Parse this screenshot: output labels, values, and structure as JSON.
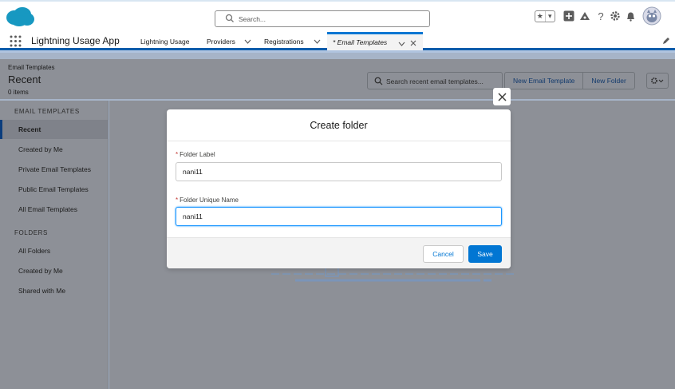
{
  "global_header": {
    "search_placeholder": "Search...",
    "icons": [
      "favorites-star-icon",
      "favorites-dropdown-icon",
      "add-icon",
      "trailhead-icon",
      "help-icon",
      "setup-gear-icon",
      "notifications-bell-icon",
      "user-avatar"
    ]
  },
  "nav": {
    "app_name": "Lightning Usage App",
    "items": [
      {
        "label": "Lightning Usage"
      },
      {
        "label": "Providers"
      },
      {
        "label": "Registrations"
      }
    ],
    "active_tab": {
      "label": "* Email Templates"
    }
  },
  "page_header": {
    "object_label": "Email Templates",
    "title": "Recent",
    "count": "0 items",
    "search_placeholder": "Search recent email templates...",
    "buttons": {
      "new_template": "New Email Template",
      "new_folder": "New Folder"
    }
  },
  "sidebar": {
    "section_templates": "EMAIL TEMPLATES",
    "template_items": [
      {
        "label": "Recent"
      },
      {
        "label": "Created by Me"
      },
      {
        "label": "Private Email Templates"
      },
      {
        "label": "Public Email Templates"
      },
      {
        "label": "All Email Templates"
      }
    ],
    "section_folders": "FOLDERS",
    "folder_items": [
      {
        "label": "All Folders"
      },
      {
        "label": "Created by Me"
      },
      {
        "label": "Shared with Me"
      }
    ]
  },
  "modal": {
    "title": "Create folder",
    "required_marker": "*",
    "folder_label": {
      "label": "Folder Label",
      "value": "nani11"
    },
    "folder_unique_name": {
      "label": "Folder Unique Name",
      "value": "nani11"
    },
    "cancel_label": "Cancel",
    "save_label": "Save"
  },
  "colors": {
    "brand_blue": "#0176d3",
    "nav_active_border": "#0176d3",
    "required_red": "#c23934",
    "overlay_grey": "#8d9097"
  }
}
